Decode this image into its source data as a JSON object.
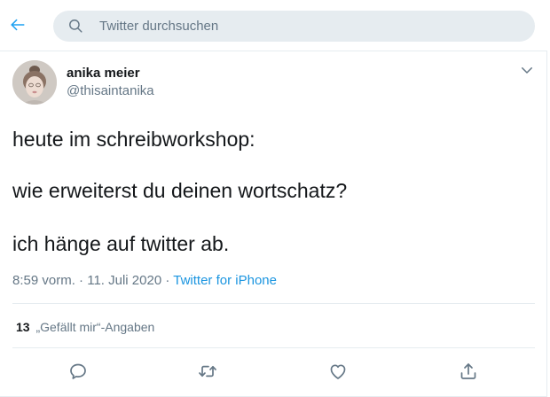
{
  "header": {
    "search_placeholder": "Twitter durchsuchen"
  },
  "tweet": {
    "author_name": "anika meier",
    "author_handle": "@thisaintanika",
    "lines": [
      "heute im schreibworkshop:",
      "wie erweiterst du deinen wortschatz?",
      "ich hänge auf twitter ab."
    ],
    "time": "8:59 vorm.",
    "separator": "·",
    "date": "11. Juli 2020",
    "source": "Twitter for iPhone",
    "likes_count": "13",
    "likes_label": "„Gefällt mir“-Angaben"
  },
  "icons": {
    "back": "arrow-left-icon",
    "search": "search-icon",
    "caret": "chevron-down-icon",
    "reply": "reply-icon",
    "retweet": "retweet-icon",
    "like": "heart-icon",
    "share": "share-icon"
  },
  "colors": {
    "accent": "#1da1f2",
    "link": "#1b95e0",
    "text": "#14171a",
    "muted": "#657786",
    "search_bg": "#e6ecf0"
  }
}
